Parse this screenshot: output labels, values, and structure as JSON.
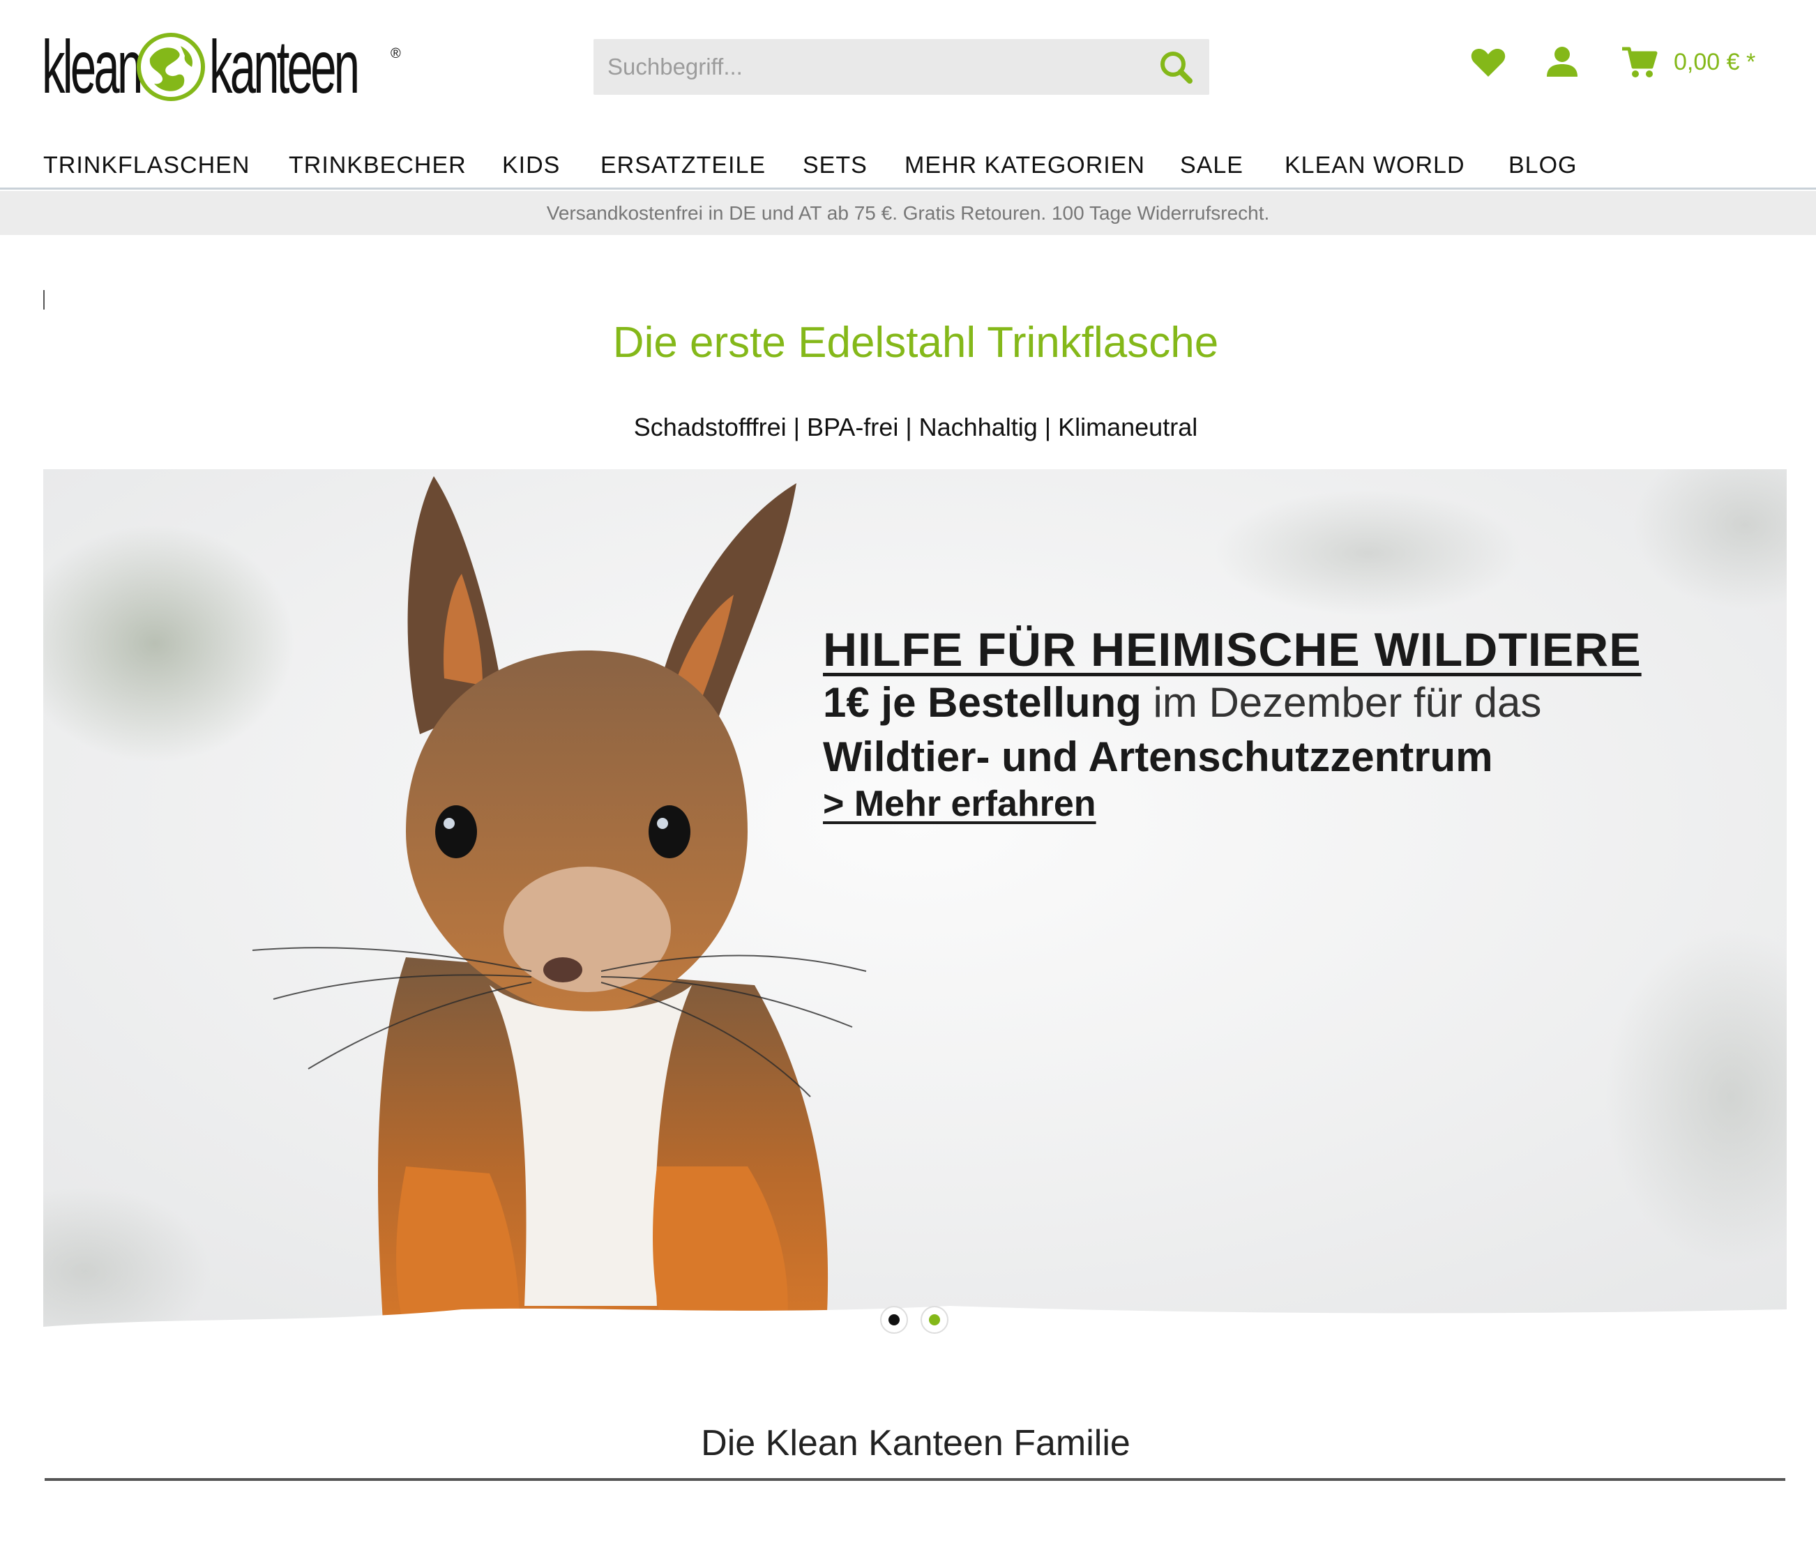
{
  "brand": {
    "name_left": "klean",
    "name_right": "kanteen",
    "registered": "®",
    "accent": "#84b819"
  },
  "search": {
    "placeholder": "Suchbegriff...",
    "icon": "search-icon"
  },
  "header_icons": {
    "wishlist": "heart-icon",
    "account": "user-icon",
    "cart": "cart-icon"
  },
  "cart": {
    "total": "0,00 € *"
  },
  "nav": {
    "items": [
      {
        "label": "TRINKFLASCHEN"
      },
      {
        "label": "TRINKBECHER"
      },
      {
        "label": "KIDS"
      },
      {
        "label": "ERSATZTEILE"
      },
      {
        "label": "SETS"
      },
      {
        "label": "MEHR KATEGORIEN"
      },
      {
        "label": "SALE"
      },
      {
        "label": "KLEAN WORLD"
      },
      {
        "label": "BLOG"
      }
    ]
  },
  "promo_bar": {
    "text": "Versandkostenfrei in DE und AT ab 75 €. Gratis Retouren. 100 Tage Widerrufsrecht."
  },
  "hero": {
    "title": "Die erste Edelstahl Trinkflasche",
    "subtitle": "Schadstofffrei | BPA-frei | Nachhaltig | Klimaneutral"
  },
  "banner": {
    "heading": "HILFE FÜR HEIMISCHE WILDTIERE",
    "line1_bold": "1€ je Bestellung",
    "line1_rest": " im Dezember für das",
    "line2": "Wildtier- und Artenschutzzentrum",
    "link": "> Mehr erfahren",
    "slides": [
      {
        "active": false,
        "color": "#111111"
      },
      {
        "active": true,
        "color": "#84b819"
      }
    ]
  },
  "family": {
    "title": "Die Klean Kanteen Familie"
  }
}
